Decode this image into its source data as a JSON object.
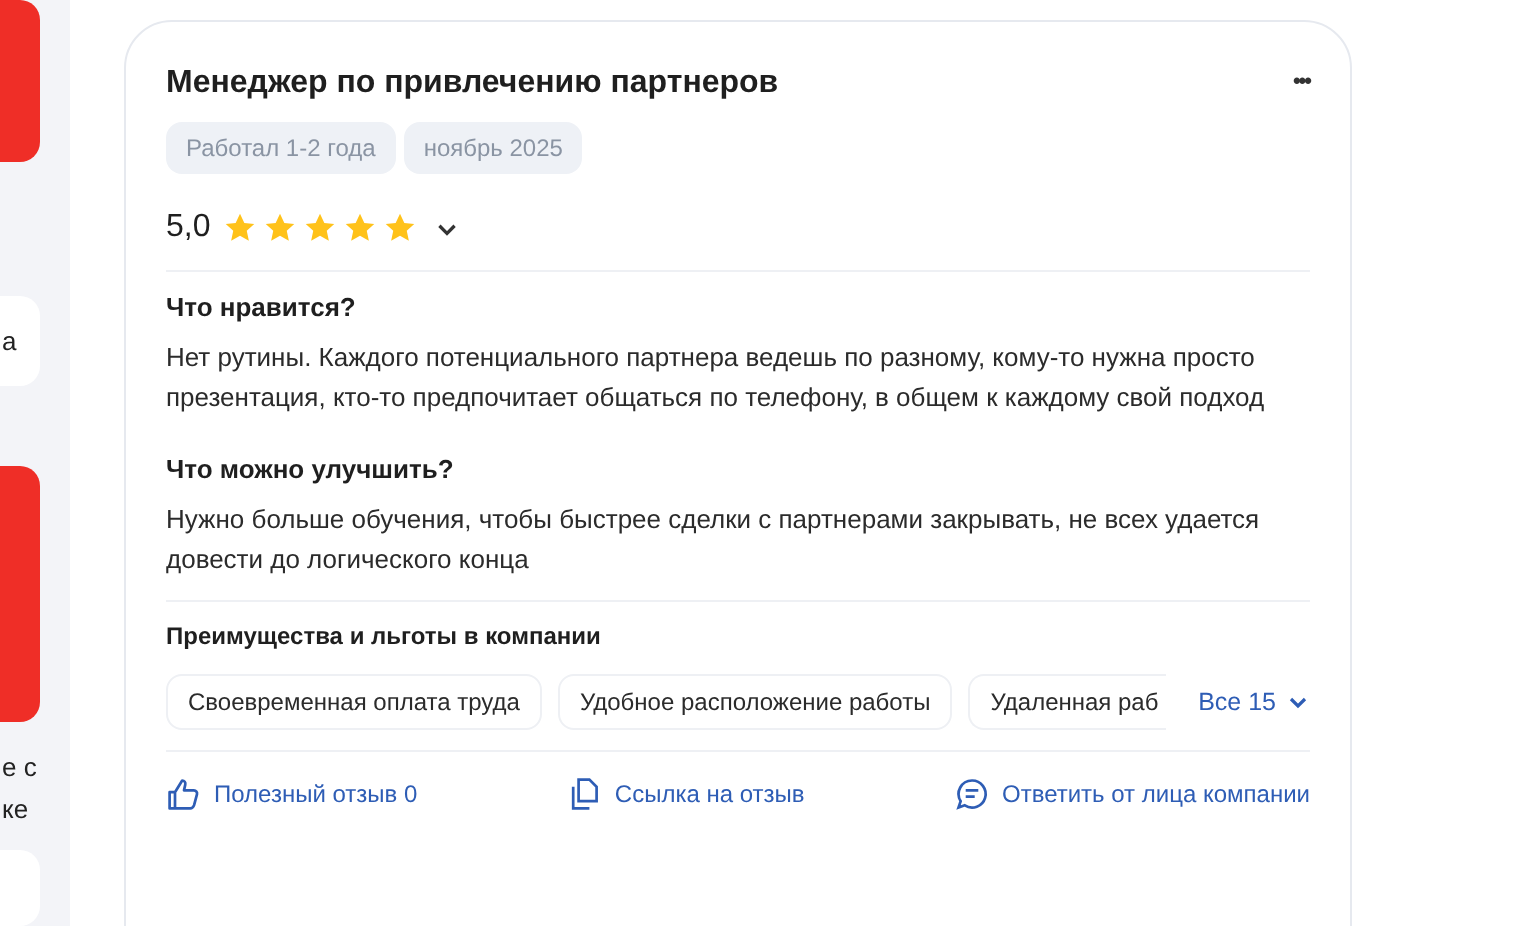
{
  "side_column": {
    "items": [
      {
        "kind": "promo"
      },
      {
        "kind": "card",
        "text": "а"
      },
      {
        "kind": "promo"
      },
      {
        "kind": "text",
        "text": "е с ке"
      },
      {
        "kind": "card"
      }
    ]
  },
  "review": {
    "title": "Менеджер по привлечению партнеров",
    "more": "•••",
    "tags": [
      "Работал 1-2 года",
      "ноябрь 2025"
    ],
    "rating": {
      "value": "5,0",
      "stars": 5,
      "expanded": false
    },
    "sections": [
      {
        "heading": "Что нравится?",
        "text": "Нет рутины. Каждого потенциального партнера ведешь по разному, кому-то нужна просто презентация, кто-то предпочитает общаться по телефону, в общем к каждому свой подход"
      },
      {
        "heading": "Что можно улучшить?",
        "text": "Нужно больше обучения, чтобы быстрее сделки с партнерами закрывать, не всех удается довести до логического конца"
      }
    ],
    "benefits": {
      "title": "Преимущества и льготы в компании",
      "items": [
        "Своевременная оплата труда",
        "Удобное расположение работы",
        "Удаленная раб"
      ],
      "more": "Все 15"
    },
    "actions": [
      {
        "kind": "like",
        "label": "Полезный отзыв 0"
      },
      {
        "kind": "link",
        "label": "Ссылка на отзыв"
      },
      {
        "kind": "reply",
        "label": "Ответить от лица компании"
      }
    ]
  }
}
